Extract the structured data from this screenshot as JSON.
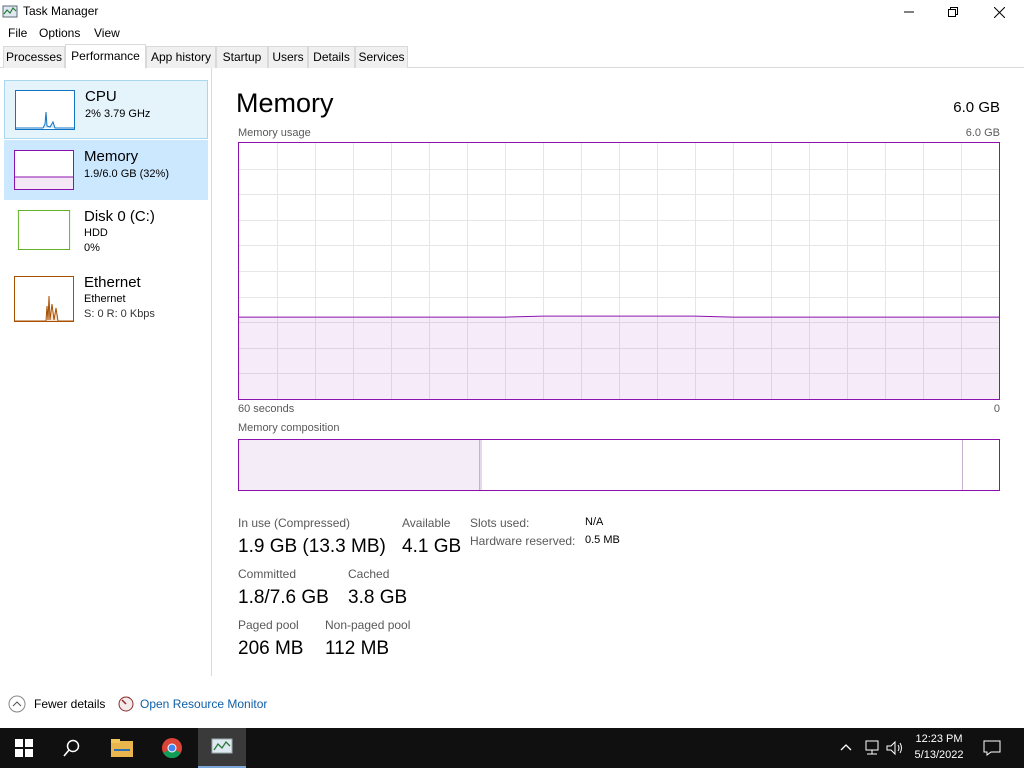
{
  "window": {
    "title": "Task Manager"
  },
  "menu": [
    "File",
    "Options",
    "View"
  ],
  "tabs": [
    "Processes",
    "Performance",
    "App history",
    "Startup",
    "Users",
    "Details",
    "Services"
  ],
  "sidebar": [
    {
      "title": "CPU",
      "line1": "2% 3.79 GHz",
      "line2": ""
    },
    {
      "title": "Memory",
      "line1": "1.9/6.0 GB (32%)",
      "line2": ""
    },
    {
      "title": "Disk 0 (C:)",
      "line1": "HDD",
      "line2": "0%"
    },
    {
      "title": "Ethernet",
      "line1": "Ethernet",
      "line2": "S: 0 R: 0 Kbps"
    }
  ],
  "main": {
    "title": "Memory",
    "total": "6.0 GB",
    "usage_label": "Memory usage",
    "usage_max": "6.0 GB",
    "time_left": "60 seconds",
    "time_right": "0",
    "composition_label": "Memory composition",
    "usage_fraction": 0.32
  },
  "stats": {
    "in_use_label": "In use (Compressed)",
    "in_use_value": "1.9 GB (13.3 MB)",
    "available_label": "Available",
    "available_value": "4.1 GB",
    "committed_label": "Committed",
    "committed_value": "1.8/7.6 GB",
    "cached_label": "Cached",
    "cached_value": "3.8 GB",
    "paged_label": "Paged pool",
    "paged_value": "206 MB",
    "nonpaged_label": "Non-paged pool",
    "nonpaged_value": "112 MB",
    "slots_label": "Slots used:",
    "slots_value": "N/A",
    "hw_label": "Hardware reserved:",
    "hw_value": "0.5 MB"
  },
  "footer": {
    "fewer": "Fewer details",
    "resmon": "Open Resource Monitor"
  },
  "taskbar": {
    "time": "12:23 PM",
    "date": "5/13/2022"
  },
  "colors": {
    "memory": "#8b12ae",
    "cpu": "#1174c4",
    "disk": "#4da60c",
    "ethernet": "#a74f01"
  }
}
